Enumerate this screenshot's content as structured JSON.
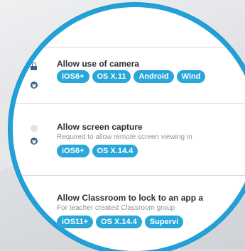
{
  "settings": [
    {
      "title": "Allow use of camera",
      "description": "",
      "tags": [
        "iOS6+",
        "OS X.11",
        "Android",
        "Wind"
      ]
    },
    {
      "title": "Allow screen capture",
      "description": "Required to allow remote screen viewing in",
      "tags": [
        "iOS6+",
        "OS X.14.4"
      ]
    },
    {
      "title": "Allow Classroom to lock to an app a",
      "description": "For teacher created Classroom group",
      "tags": [
        "iOS11+",
        "OS X.14.4",
        "Supervi"
      ]
    }
  ],
  "colors": {
    "accent": "#2aa7d9",
    "ring": "#21a1d8",
    "icon": "#3b5f86"
  }
}
